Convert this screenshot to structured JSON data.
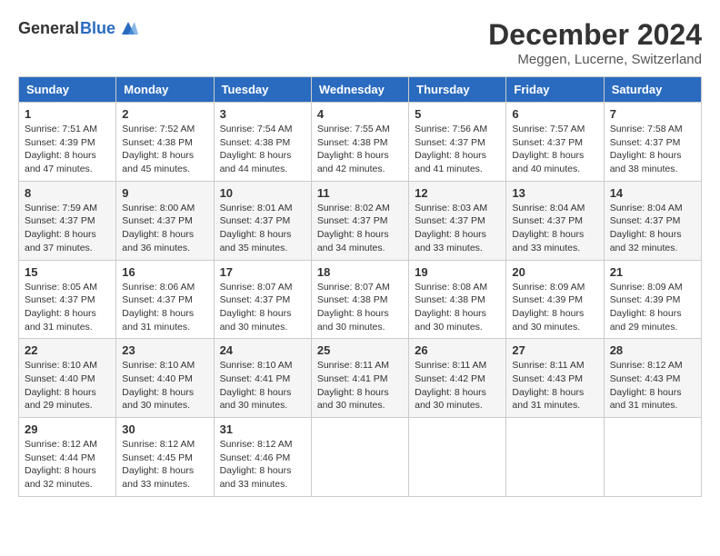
{
  "logo": {
    "general": "General",
    "blue": "Blue"
  },
  "title": "December 2024",
  "location": "Meggen, Lucerne, Switzerland",
  "days_of_week": [
    "Sunday",
    "Monday",
    "Tuesday",
    "Wednesday",
    "Thursday",
    "Friday",
    "Saturday"
  ],
  "weeks": [
    [
      {
        "day": "1",
        "sunrise": "7:51 AM",
        "sunset": "4:39 PM",
        "daylight": "8 hours and 47 minutes."
      },
      {
        "day": "2",
        "sunrise": "7:52 AM",
        "sunset": "4:38 PM",
        "daylight": "8 hours and 45 minutes."
      },
      {
        "day": "3",
        "sunrise": "7:54 AM",
        "sunset": "4:38 PM",
        "daylight": "8 hours and 44 minutes."
      },
      {
        "day": "4",
        "sunrise": "7:55 AM",
        "sunset": "4:38 PM",
        "daylight": "8 hours and 42 minutes."
      },
      {
        "day": "5",
        "sunrise": "7:56 AM",
        "sunset": "4:37 PM",
        "daylight": "8 hours and 41 minutes."
      },
      {
        "day": "6",
        "sunrise": "7:57 AM",
        "sunset": "4:37 PM",
        "daylight": "8 hours and 40 minutes."
      },
      {
        "day": "7",
        "sunrise": "7:58 AM",
        "sunset": "4:37 PM",
        "daylight": "8 hours and 38 minutes."
      }
    ],
    [
      {
        "day": "8",
        "sunrise": "7:59 AM",
        "sunset": "4:37 PM",
        "daylight": "8 hours and 37 minutes."
      },
      {
        "day": "9",
        "sunrise": "8:00 AM",
        "sunset": "4:37 PM",
        "daylight": "8 hours and 36 minutes."
      },
      {
        "day": "10",
        "sunrise": "8:01 AM",
        "sunset": "4:37 PM",
        "daylight": "8 hours and 35 minutes."
      },
      {
        "day": "11",
        "sunrise": "8:02 AM",
        "sunset": "4:37 PM",
        "daylight": "8 hours and 34 minutes."
      },
      {
        "day": "12",
        "sunrise": "8:03 AM",
        "sunset": "4:37 PM",
        "daylight": "8 hours and 33 minutes."
      },
      {
        "day": "13",
        "sunrise": "8:04 AM",
        "sunset": "4:37 PM",
        "daylight": "8 hours and 33 minutes."
      },
      {
        "day": "14",
        "sunrise": "8:04 AM",
        "sunset": "4:37 PM",
        "daylight": "8 hours and 32 minutes."
      }
    ],
    [
      {
        "day": "15",
        "sunrise": "8:05 AM",
        "sunset": "4:37 PM",
        "daylight": "8 hours and 31 minutes."
      },
      {
        "day": "16",
        "sunrise": "8:06 AM",
        "sunset": "4:37 PM",
        "daylight": "8 hours and 31 minutes."
      },
      {
        "day": "17",
        "sunrise": "8:07 AM",
        "sunset": "4:37 PM",
        "daylight": "8 hours and 30 minutes."
      },
      {
        "day": "18",
        "sunrise": "8:07 AM",
        "sunset": "4:38 PM",
        "daylight": "8 hours and 30 minutes."
      },
      {
        "day": "19",
        "sunrise": "8:08 AM",
        "sunset": "4:38 PM",
        "daylight": "8 hours and 30 minutes."
      },
      {
        "day": "20",
        "sunrise": "8:09 AM",
        "sunset": "4:39 PM",
        "daylight": "8 hours and 30 minutes."
      },
      {
        "day": "21",
        "sunrise": "8:09 AM",
        "sunset": "4:39 PM",
        "daylight": "8 hours and 29 minutes."
      }
    ],
    [
      {
        "day": "22",
        "sunrise": "8:10 AM",
        "sunset": "4:40 PM",
        "daylight": "8 hours and 29 minutes."
      },
      {
        "day": "23",
        "sunrise": "8:10 AM",
        "sunset": "4:40 PM",
        "daylight": "8 hours and 30 minutes."
      },
      {
        "day": "24",
        "sunrise": "8:10 AM",
        "sunset": "4:41 PM",
        "daylight": "8 hours and 30 minutes."
      },
      {
        "day": "25",
        "sunrise": "8:11 AM",
        "sunset": "4:41 PM",
        "daylight": "8 hours and 30 minutes."
      },
      {
        "day": "26",
        "sunrise": "8:11 AM",
        "sunset": "4:42 PM",
        "daylight": "8 hours and 30 minutes."
      },
      {
        "day": "27",
        "sunrise": "8:11 AM",
        "sunset": "4:43 PM",
        "daylight": "8 hours and 31 minutes."
      },
      {
        "day": "28",
        "sunrise": "8:12 AM",
        "sunset": "4:43 PM",
        "daylight": "8 hours and 31 minutes."
      }
    ],
    [
      {
        "day": "29",
        "sunrise": "8:12 AM",
        "sunset": "4:44 PM",
        "daylight": "8 hours and 32 minutes."
      },
      {
        "day": "30",
        "sunrise": "8:12 AM",
        "sunset": "4:45 PM",
        "daylight": "8 hours and 33 minutes."
      },
      {
        "day": "31",
        "sunrise": "8:12 AM",
        "sunset": "4:46 PM",
        "daylight": "8 hours and 33 minutes."
      },
      null,
      null,
      null,
      null
    ]
  ]
}
